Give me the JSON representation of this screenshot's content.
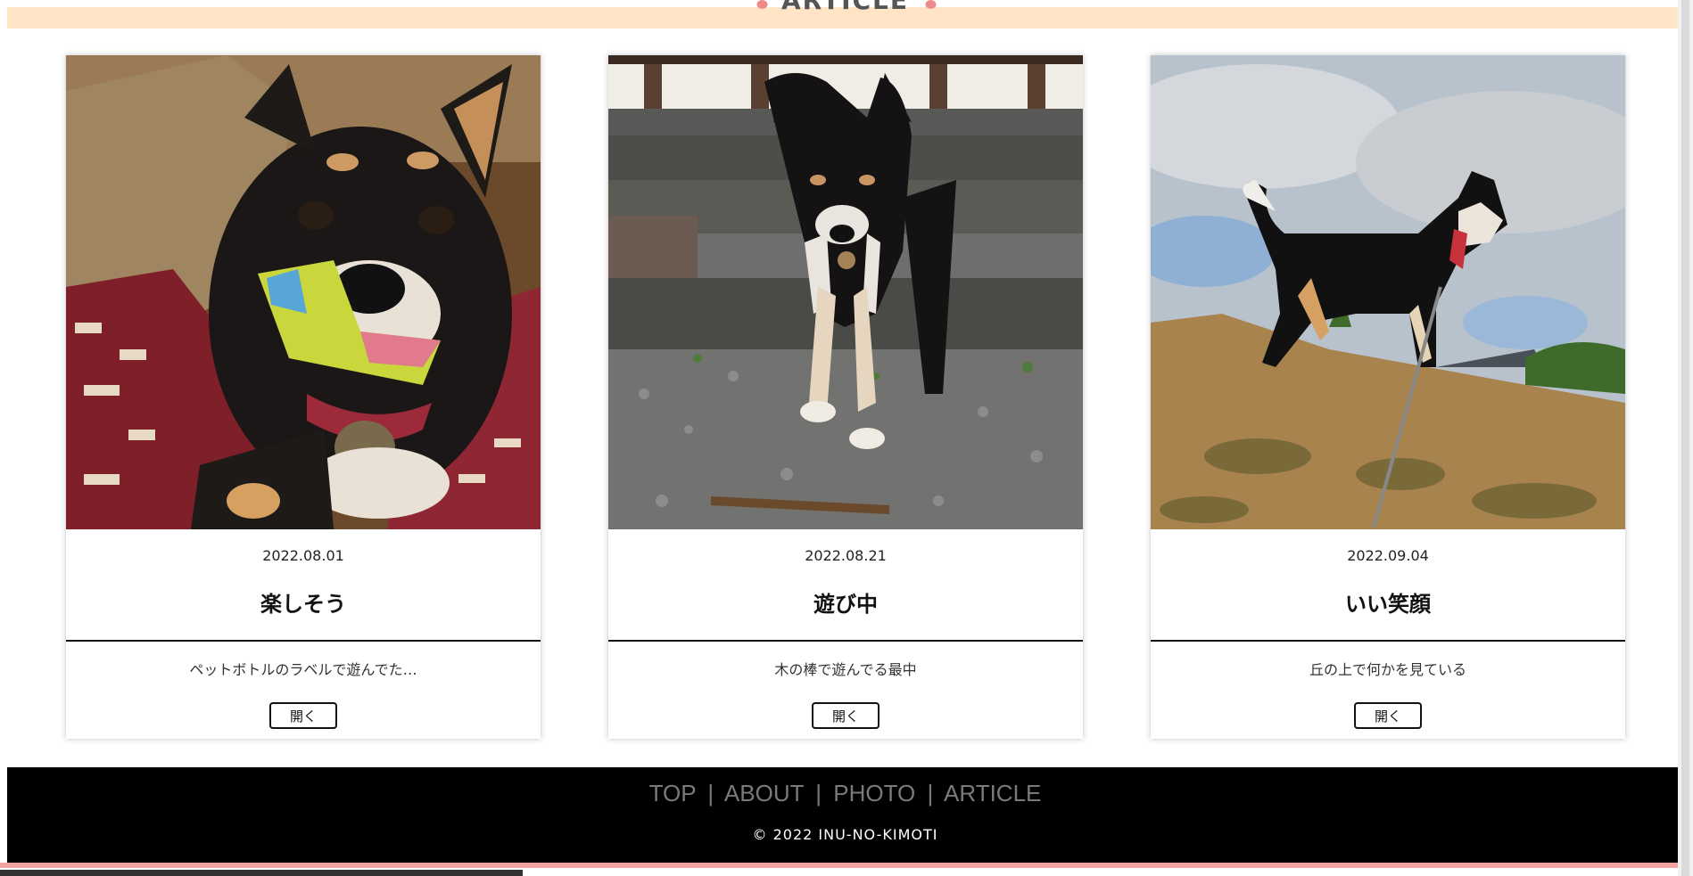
{
  "section": {
    "title": "ARTICLE"
  },
  "colors": {
    "band": "#ffe4c6",
    "paw": "#f08a8a",
    "footer_bg": "#000000",
    "footer_link": "#7a7a7a",
    "bottom_strip": "#f4a3a3"
  },
  "cards": [
    {
      "image_icon": "shiba-dog-with-wrapper-photo",
      "date": "2022.08.01",
      "title": "楽しそう",
      "description": "ペットボトルのラベルで遊んでた…",
      "button_label": "開く"
    },
    {
      "image_icon": "shiba-dog-on-gravel-photo",
      "date": "2022.08.21",
      "title": "遊び中",
      "description": "木の棒で遊んでる最中",
      "button_label": "開く"
    },
    {
      "image_icon": "shiba-dog-on-hill-photo",
      "date": "2022.09.04",
      "title": "いい笑顔",
      "description": "丘の上で何かを見ている",
      "button_label": "開く"
    }
  ],
  "footer": {
    "nav": [
      "TOP",
      "ABOUT",
      "PHOTO",
      "ARTICLE"
    ],
    "separator": "|",
    "copyright": "© 2022 INU-NO-KIMOTI"
  }
}
